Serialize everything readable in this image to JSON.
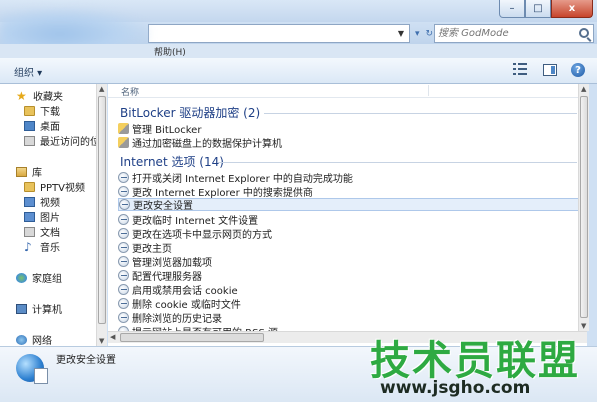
{
  "window": {
    "menu_help": "帮助(H)",
    "search_placeholder": "搜索 GodMode",
    "minimize": "–",
    "maximize": "□",
    "close": "x"
  },
  "toolbar": {
    "organize": "组织 ▾"
  },
  "sidebar": {
    "items": [
      {
        "label": "收藏夹",
        "icon": "star-icon"
      },
      {
        "label": "下载",
        "icon": "folder-icon"
      },
      {
        "label": "桌面",
        "icon": "desktop-icon"
      },
      {
        "label": "最近访问的位置",
        "icon": "recent-places-icon"
      },
      {
        "label": "库",
        "icon": "library-icon"
      },
      {
        "label": "PPTV视频",
        "icon": "video-folder-icon"
      },
      {
        "label": "视频",
        "icon": "video-icon"
      },
      {
        "label": "图片",
        "icon": "picture-icon"
      },
      {
        "label": "文档",
        "icon": "document-icon"
      },
      {
        "label": "音乐",
        "icon": "music-icon"
      },
      {
        "label": "家庭组",
        "icon": "homegroup-icon"
      },
      {
        "label": "计算机",
        "icon": "computer-icon"
      },
      {
        "label": "网络",
        "icon": "network-icon"
      }
    ]
  },
  "content": {
    "column_name": "名称",
    "groups": [
      {
        "title": "BitLocker 驱动器加密 (2)",
        "items": [
          "管理 BitLocker",
          "通过加密磁盘上的数据保护计算机"
        ]
      },
      {
        "title": "Internet 选项 (14)",
        "items": [
          "打开或关闭 Internet Explorer 中的自动完成功能",
          "更改 Internet Explorer 中的搜索提供商",
          "更改安全设置",
          "更改临时 Internet 文件设置",
          "更改在选项卡中显示网页的方式",
          "更改主页",
          "管理浏览器加载项",
          "配置代理服务器",
          "启用或禁用会话 cookie",
          "删除 cookie 或临时文件",
          "删除浏览的历史记录",
          "提示网站上是否有可用的 RSS 源"
        ]
      }
    ]
  },
  "details": {
    "title": "更改安全设置"
  },
  "watermark": {
    "text": "技术员联盟",
    "url": "www.jsgho.com"
  }
}
